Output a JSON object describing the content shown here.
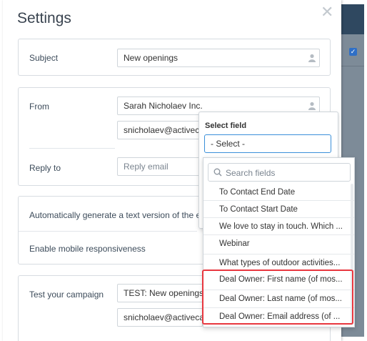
{
  "modal": {
    "title": "Settings",
    "close_glyph": "✕"
  },
  "subject": {
    "label": "Subject",
    "value": "New openings"
  },
  "from": {
    "label": "From",
    "name_value": "Sarah Nicholaev Inc.",
    "email_value": "snicholaev@activecampa"
  },
  "reply_to": {
    "label": "Reply to",
    "placeholder": "Reply email"
  },
  "options": {
    "auto_text_label": "Automatically generate a text version of the ema",
    "mobile_label": "Enable mobile responsiveness"
  },
  "test": {
    "label": "Test your campaign",
    "subject_value": "TEST: New openings",
    "email_value": "snicholaev@activecampa"
  },
  "field_picker": {
    "title": "Select field",
    "selected": "- Select -",
    "search_placeholder": "Search fields",
    "items": [
      "To Contact End Date",
      "To Contact Start Date",
      "We love to stay in touch. Which ...",
      "Webinar",
      "What types of outdoor activities...",
      "Deal Owner: First name (of mos...",
      "Deal Owner: Last name (of mos...",
      "Deal Owner: Email address (of ..."
    ]
  },
  "colors": {
    "accent": "#3a8fd9",
    "highlight": "#e8373f",
    "button": "#2e6fd1"
  },
  "icons": [
    "person-icon",
    "search-icon",
    "close-icon",
    "checkbox-icon"
  ]
}
